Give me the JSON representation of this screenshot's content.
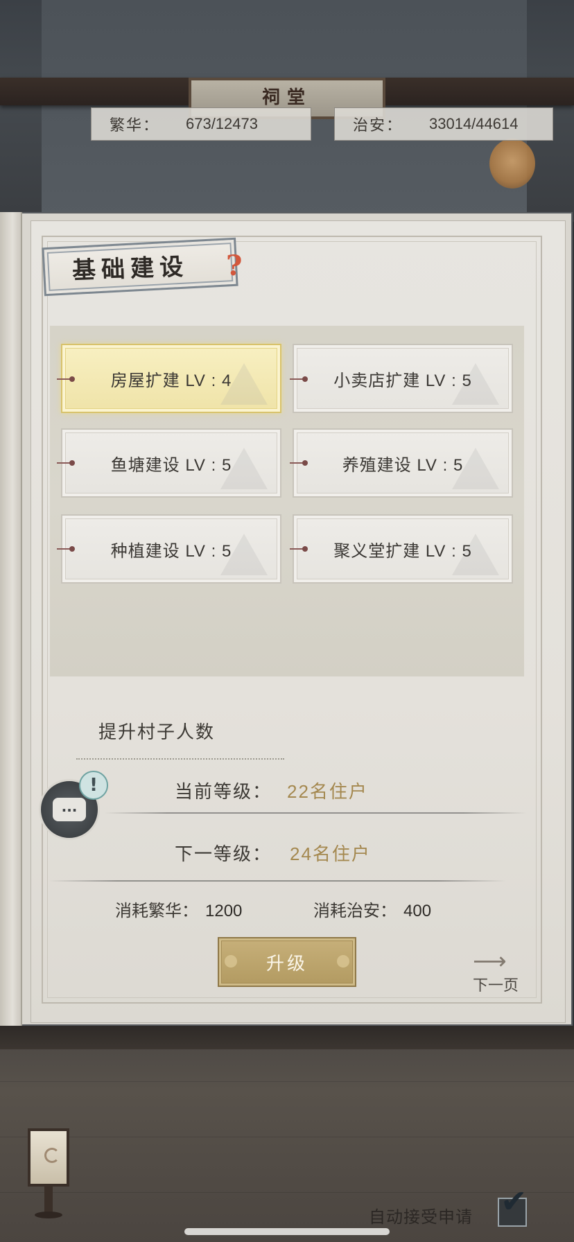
{
  "scene": {
    "plaque_text": "祠堂"
  },
  "stats": {
    "prosperity": {
      "label": "繁华：",
      "value": "673/12473"
    },
    "security": {
      "label": "治安：",
      "value": "33014/44614"
    }
  },
  "panel": {
    "title": "基础建设",
    "help_glyph": "?",
    "buildings": [
      {
        "label": "房屋扩建 LV : 4",
        "selected": true
      },
      {
        "label": "小卖店扩建 LV : 5",
        "selected": false
      },
      {
        "label": "鱼塘建设 LV : 5",
        "selected": false
      },
      {
        "label": "养殖建设 LV : 5",
        "selected": false
      },
      {
        "label": "种植建设 LV : 5",
        "selected": false
      },
      {
        "label": "聚义堂扩建 LV : 5",
        "selected": false
      }
    ],
    "detail": {
      "section_title": "提升村子人数",
      "current_label": "当前等级：",
      "current_value": "22名住户",
      "next_label": "下一等级：",
      "next_value": "24名住户",
      "cost_prosperity_label": "消耗繁华：",
      "cost_prosperity_value": "1200",
      "cost_security_label": "消耗治安：",
      "cost_security_value": "400"
    },
    "upgrade_button": "升级",
    "next_page": "下一页"
  },
  "chat": {
    "glyph": "...",
    "alert_glyph": "!"
  },
  "footer": {
    "auto_accept_label": "自动接受申请",
    "auto_accept_checked": true
  },
  "colors": {
    "accent_gold": "#a4884f",
    "button_gold": "#b29a61",
    "selected_card": "#f8f0c2",
    "help_red": "#d2573c"
  },
  "icons": [
    "help-icon",
    "chat-icon",
    "alert-icon",
    "next-arrow-icon",
    "check-icon",
    "lamp-icon"
  ]
}
